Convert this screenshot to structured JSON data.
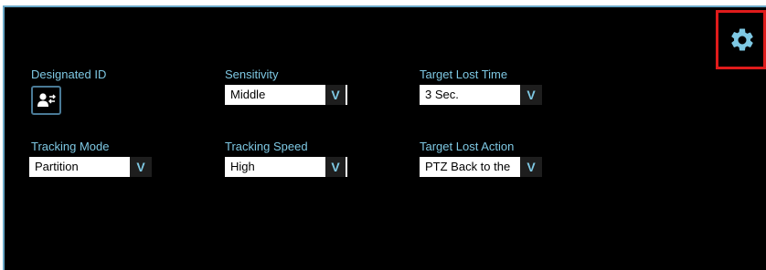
{
  "settings": {
    "designated_id": {
      "label": "Designated ID"
    },
    "sensitivity": {
      "label": "Sensitivity",
      "value": "Middle"
    },
    "target_lost_time": {
      "label": "Target Lost Time",
      "value": "3 Sec."
    },
    "tracking_mode": {
      "label": "Tracking Mode",
      "value": "Partition"
    },
    "tracking_speed": {
      "label": "Tracking Speed",
      "value": "High"
    },
    "target_lost_action": {
      "label": "Target Lost Action",
      "value": "PTZ Back to the"
    }
  },
  "icons": {
    "gear": "gear-icon",
    "designate": "person-swap-icon",
    "dropdown": "chevron-down-icon",
    "dropdown_glyph": "V"
  },
  "colors": {
    "background": "#000000",
    "label": "#7ec8e3",
    "highlight": "#e01b1b"
  }
}
